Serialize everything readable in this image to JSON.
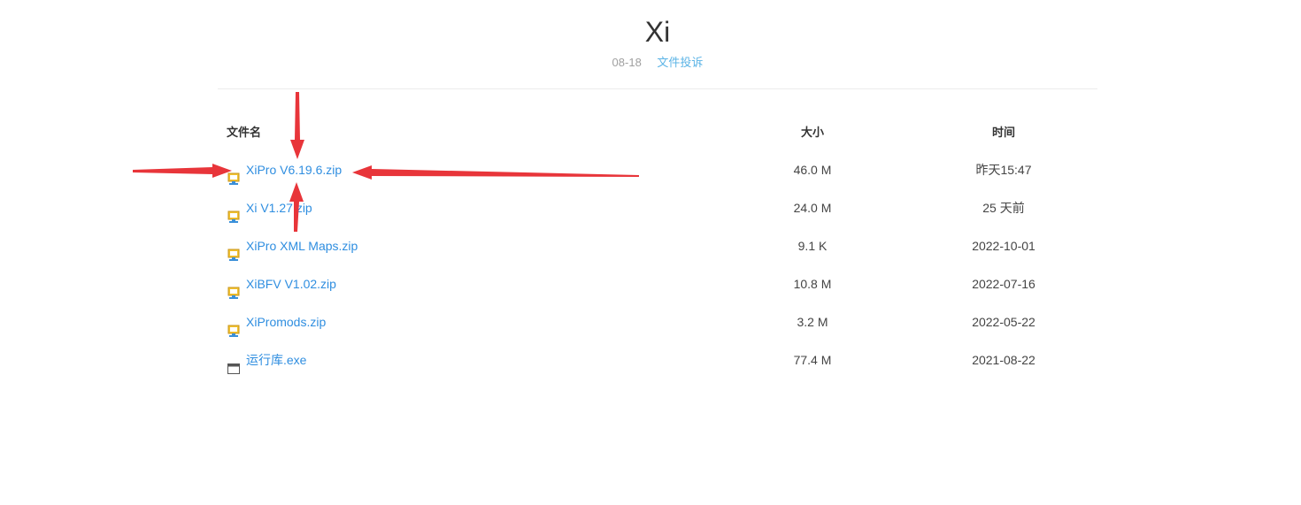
{
  "page": {
    "title": "Xi",
    "date": "08-18",
    "report_label": "文件投诉"
  },
  "table": {
    "headers": {
      "name": "文件名",
      "size": "大小",
      "time": "时间"
    },
    "rows": [
      {
        "name": "XiPro V6.19.6.zip",
        "size": "46.0 M",
        "time": "昨天15:47",
        "icon": "zip-icon"
      },
      {
        "name": "Xi V1.27.zip",
        "size": "24.0 M",
        "time": "25 天前",
        "icon": "zip-icon"
      },
      {
        "name": "XiPro XML Maps.zip",
        "size": "9.1 K",
        "time": "2022-10-01",
        "icon": "zip-icon"
      },
      {
        "name": "XiBFV V1.02.zip",
        "size": "10.8 M",
        "time": "2022-07-16",
        "icon": "zip-icon"
      },
      {
        "name": "XiPromods.zip",
        "size": "3.2 M",
        "time": "2022-05-22",
        "icon": "zip-icon"
      },
      {
        "name": "运行库.exe",
        "size": "77.4 M",
        "time": "2021-08-22",
        "icon": "exe-window-icon"
      }
    ]
  },
  "colors": {
    "link": "#2f8ee0",
    "report": "#5cb4e6",
    "annotation_arrow": "#e8353a"
  }
}
